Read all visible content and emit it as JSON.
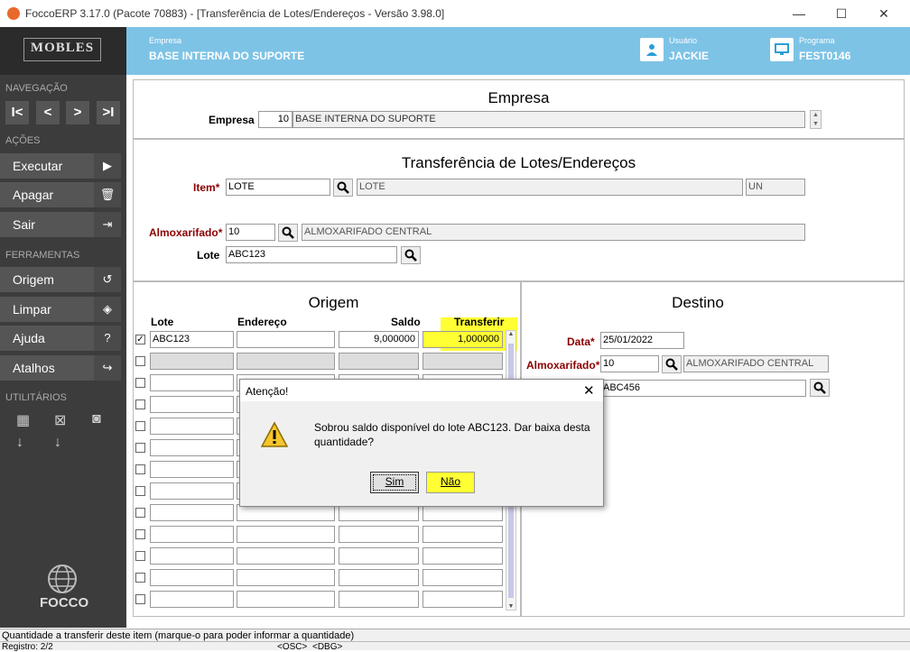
{
  "window": {
    "title": "FoccoERP 3.17.0 (Pacote 70883) - [Transferência de Lotes/Endereços - Versão 3.98.0]"
  },
  "logo": {
    "text": "MOBLES"
  },
  "header": {
    "empresa_label": "Empresa",
    "empresa_value": "BASE INTERNA DO SUPORTE",
    "usuario_label": "Usuário",
    "usuario_value": "JACKIE",
    "programa_label": "Programa",
    "programa_value": "FEST0146"
  },
  "sidebar": {
    "nav_heading": "NAVEGAÇÃO",
    "nav": {
      "first": "I<",
      "prev": "<",
      "next": ">",
      "last": ">I"
    },
    "acoes_heading": "AÇÕES",
    "acoes": [
      {
        "label": "Executar",
        "glyph": "▶"
      },
      {
        "label": "Apagar",
        "glyph": "🗑"
      },
      {
        "label": "Sair",
        "glyph": "⇥"
      }
    ],
    "ferramentas_heading": "FERRAMENTAS",
    "ferramentas": [
      {
        "label": "Origem",
        "glyph": "↺"
      },
      {
        "label": "Limpar",
        "glyph": "◈"
      },
      {
        "label": "Ajuda",
        "glyph": "?"
      },
      {
        "label": "Atalhos",
        "glyph": "↪"
      }
    ],
    "utilitarios_heading": "UTILITÁRIOS",
    "brand": "FOCCO"
  },
  "empresa_section": {
    "title": "Empresa",
    "label": "Empresa",
    "code": "10",
    "name": "BASE INTERNA DO SUPORTE"
  },
  "transfer_section": {
    "title": "Transferência de Lotes/Endereços",
    "item_label": "Item",
    "item_code": "LOTE",
    "item_desc": "LOTE",
    "item_unit": "UN",
    "almox_label": "Almoxarifado",
    "almox_code": "10",
    "almox_desc": "ALMOXARIFADO CENTRAL",
    "lote_label": "Lote",
    "lote_value": "ABC123"
  },
  "origem": {
    "title": "Origem",
    "headers": {
      "lote": "Lote",
      "endereco": "Endereço",
      "saldo": "Saldo",
      "transferir": "Transferir"
    },
    "row1": {
      "checked": "✓",
      "lote": "ABC123",
      "endereco": "",
      "saldo": "9,000000",
      "transferir": "1,000000"
    }
  },
  "destino": {
    "title": "Destino",
    "data_label": "Data",
    "data_value": "25/01/2022",
    "almox_label": "Almoxarifado",
    "almox_code": "10",
    "almox_desc": "ALMOXARIFADO CENTRAL",
    "lote_value": "ABC456"
  },
  "dialog": {
    "title": "Atenção!",
    "message_line1": "Sobrou saldo disponível do lote ABC123. Dar baixa desta",
    "message_line2": "quantidade?",
    "yes": "Sim",
    "no": "Não"
  },
  "status": {
    "hint": "Quantidade a transferir deste item (marque-o para poder informar a quantidade)",
    "registro": "Registro: 2/2",
    "osc": "<OSC>",
    "dbg": "<DBG>"
  },
  "colors": {
    "header": "#7dc3e6",
    "sidebar": "#3c3c3c",
    "highlight": "#ffff33",
    "required": "#8b0000"
  }
}
